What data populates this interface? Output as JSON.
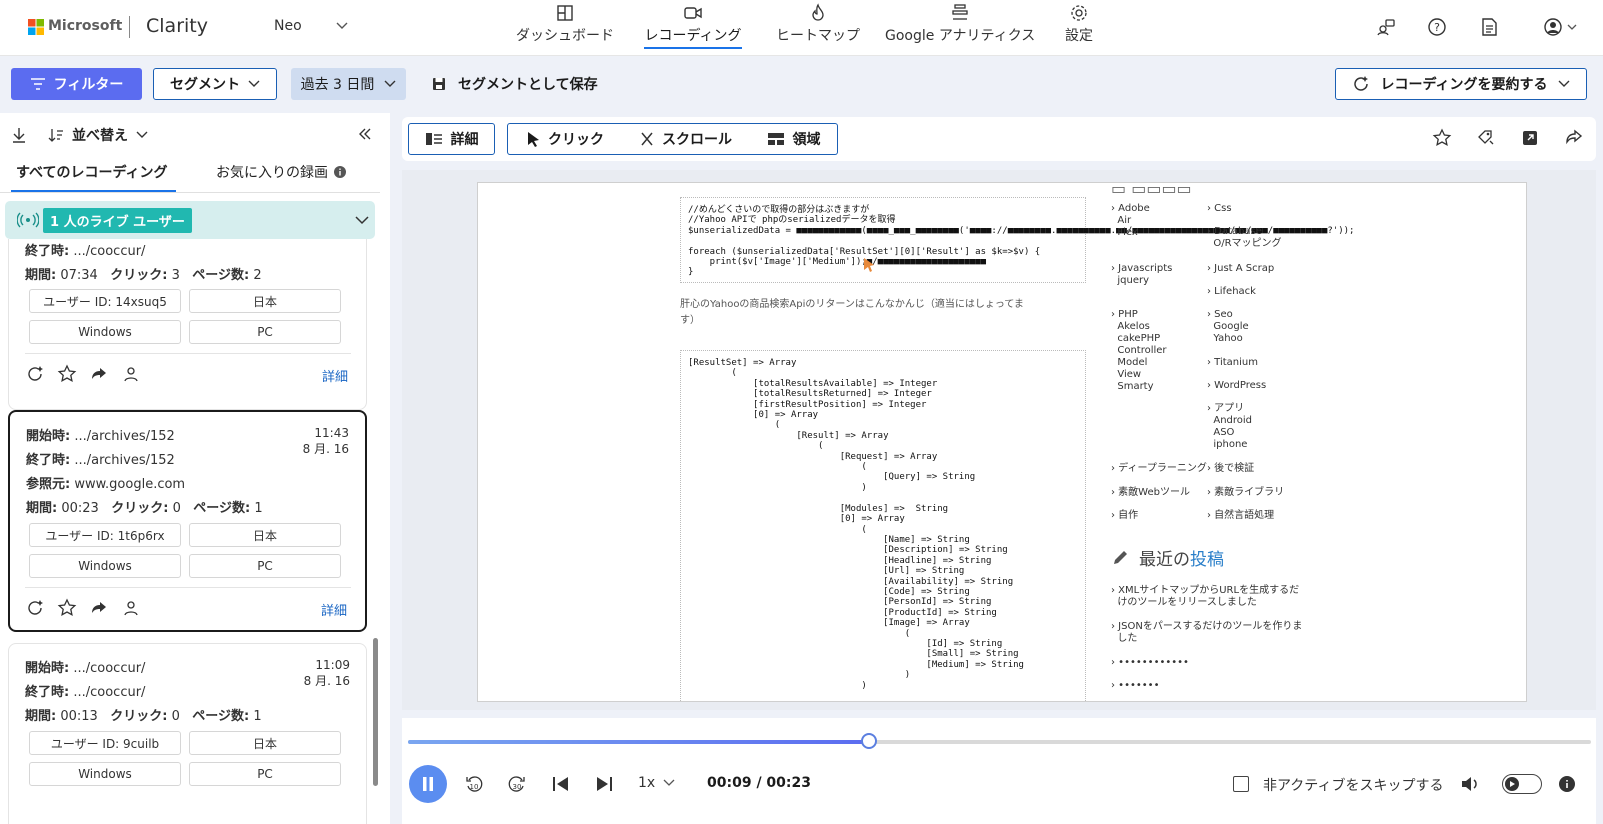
{
  "header": {
    "ms_brand": "Microsoft",
    "product": "Clarity",
    "project": "Neo",
    "nav": [
      {
        "label": "ダッシュボード",
        "icon": "dashboard-icon"
      },
      {
        "label": "レコーディング",
        "icon": "recording-icon"
      },
      {
        "label": "ヒートマップ",
        "icon": "flame-icon"
      },
      {
        "label": "Google アナリティクス",
        "icon": "analytics-icon"
      },
      {
        "label": "設定",
        "icon": "gear-icon"
      }
    ]
  },
  "filterbar": {
    "filter": "フィルター",
    "segment": "セグメント",
    "range": "過去 3 日間",
    "save_segment": "セグメントとして保存",
    "summarize": "レコーディングを要約する"
  },
  "list": {
    "sort": "並べ替え",
    "tab_all": "すべてのレコーディング",
    "tab_fav": "お気に入りの録画",
    "live": "1 人のライブ ユーザー",
    "cards": [
      {
        "end_label": "終了時:",
        "end": ".../cooccur/",
        "dur_label": "期間:",
        "dur": "07:34",
        "clicks_label": "クリック:",
        "clicks": "3",
        "pages_label": "ページ数:",
        "pages": "2",
        "user": "ユーザー ID: 14xsuq5",
        "country": "日本",
        "os": "Windows",
        "device": "PC",
        "detail": "詳細"
      },
      {
        "start_label": "開始時:",
        "start": ".../archives/152",
        "end_label": "終了時:",
        "end": ".../archives/152",
        "ref_label": "参照元:",
        "ref": "www.google.com",
        "time": "11:43",
        "date": "8 月. 16",
        "dur_label": "期間:",
        "dur": "00:23",
        "clicks_label": "クリック:",
        "clicks": "0",
        "pages_label": "ページ数:",
        "pages": "1",
        "user": "ユーザー ID: 1t6p6rx",
        "country": "日本",
        "os": "Windows",
        "device": "PC",
        "detail": "詳細"
      },
      {
        "start_label": "開始時:",
        "start": ".../cooccur/",
        "end_label": "終了時:",
        "end": ".../cooccur/",
        "time": "11:09",
        "date": "8 月. 16",
        "dur_label": "期間:",
        "dur": "00:13",
        "clicks_label": "クリック:",
        "clicks": "0",
        "pages_label": "ページ数:",
        "pages": "1",
        "user": "ユーザー ID: 9cuilb",
        "country": "日本",
        "os": "Windows",
        "device": "PC"
      }
    ]
  },
  "toolbar": {
    "detail": "詳細",
    "click": "クリック",
    "scroll": "スクロール",
    "area": "領域"
  },
  "replay": {
    "code1": "//めんどくさいので取得の部分はぶきますが\n//Yahoo APIで phpのserializedデータを取得\n$unserializedData = ■■■■■■■■■■■■(■■■■_■■■_■■■■■■■■('■■■■://■■■■■■■■.■■■■■■■■■■.■■/■■■■■■■■■■■■■■■■■■/■■/■■■/■■■■■■■■■■?'));\n\nforeach ($unserializedData['ResultSet'][0]['Result'] as $k=>$v) {\n    print($v['Image']['Medium']);■/■■■■■■■■■■■■■■■■■■■■\n}",
    "para": "肝心のYahooの商品検索Apiのリターンはこんなかんじ（適当にはしょってま\nす）",
    "code2": "[ResultSet] => Array\n        (\n            [totalResultsAvailable] => Integer\n            [totalResultsReturned] => Integer\n            [firstResultPosition] => Integer\n            [0] => Array\n                (\n                    [Result] => Array\n                        (\n                            [Request] => Array\n                                (\n                                    [Query] => String\n                                )\n\n                            [Modules] =>  String\n                            [0] => Array\n                                (\n                                    [Name] => String\n                                    [Description] => String\n                                    [Headline] => String\n                                    [Url] => String\n                                    [Availability] => String\n                                    [Code] => String\n                                    [PersonId] => String\n                                    [ProductId] => String\n                                    [Image] => Array\n                                        (\n                                            [Id] => String\n                                            [Small] => String\n                                            [Medium] => String\n                                        )\n                                )",
    "cat_left": [
      "› Adobe\n  Air\n  Flex",
      "› Javascripts\n  jquery",
      "› PHP\n  Akelos\n  cakePHP\n  Controller\n  Model\n  View\n  Smarty",
      "› ディープラーニング",
      "› 素敵Webツール",
      "› 自作"
    ],
    "cat_right": [
      "› Css",
      "› Database\n  O/Rマッピング",
      "› Just A Scrap",
      "› Lifehack",
      "› Seo\n  Google\n  Yahoo",
      "› Titanium",
      "› WordPress",
      "› アプリ\n  Android\n  ASO\n  iphone",
      "› 後で検証",
      "› 素敵ライブラリ",
      "› 自然言語処理"
    ],
    "recent_a": "最近の",
    "recent_b": "投稿",
    "posts": [
      "› XMLサイトマップからURLを生成するだ\n  けのツールをリリースしました",
      "› JSONをパースするだけのツールを作りま\n  した",
      "› ••••••••••••",
      "› •••••••"
    ]
  },
  "player": {
    "progress": 0.39,
    "speed": "1x",
    "time": "00:09 / 00:23",
    "skip": "非アクティブをスキップする"
  },
  "colors": {
    "accent": "#1a73e8",
    "filter_btn": "#5b6cf0",
    "live_badge": "#21b8b0"
  }
}
